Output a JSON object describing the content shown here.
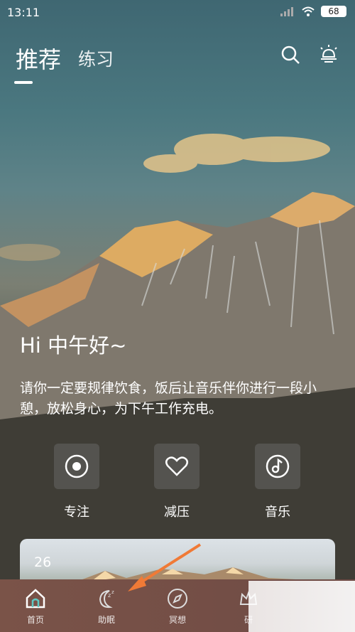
{
  "status_bar": {
    "time": "13:11",
    "battery": "68"
  },
  "tabs": [
    {
      "label": "推荐"
    },
    {
      "label": "练习"
    }
  ],
  "greeting": "Hi 中午好~",
  "message": "请你一定要规律饮食，饭后让音乐伴你进行一段小憩，放松身心，为下午工作充电。",
  "shortcuts": [
    {
      "label": "专注",
      "icon": "focus-icon"
    },
    {
      "label": "减压",
      "icon": "heart-icon"
    },
    {
      "label": "音乐",
      "icon": "music-icon"
    }
  ],
  "card": {
    "number": "26"
  },
  "bottom_nav": [
    {
      "label": "首页",
      "icon": "home-icon"
    },
    {
      "label": "助眠",
      "icon": "sleep-moon-icon"
    },
    {
      "label": "冥想",
      "icon": "compass-icon"
    },
    {
      "label": "研",
      "icon": "crown-icon"
    }
  ],
  "colors": {
    "accent_arrow": "#f07a36",
    "nav_bg": "#7a5348"
  }
}
